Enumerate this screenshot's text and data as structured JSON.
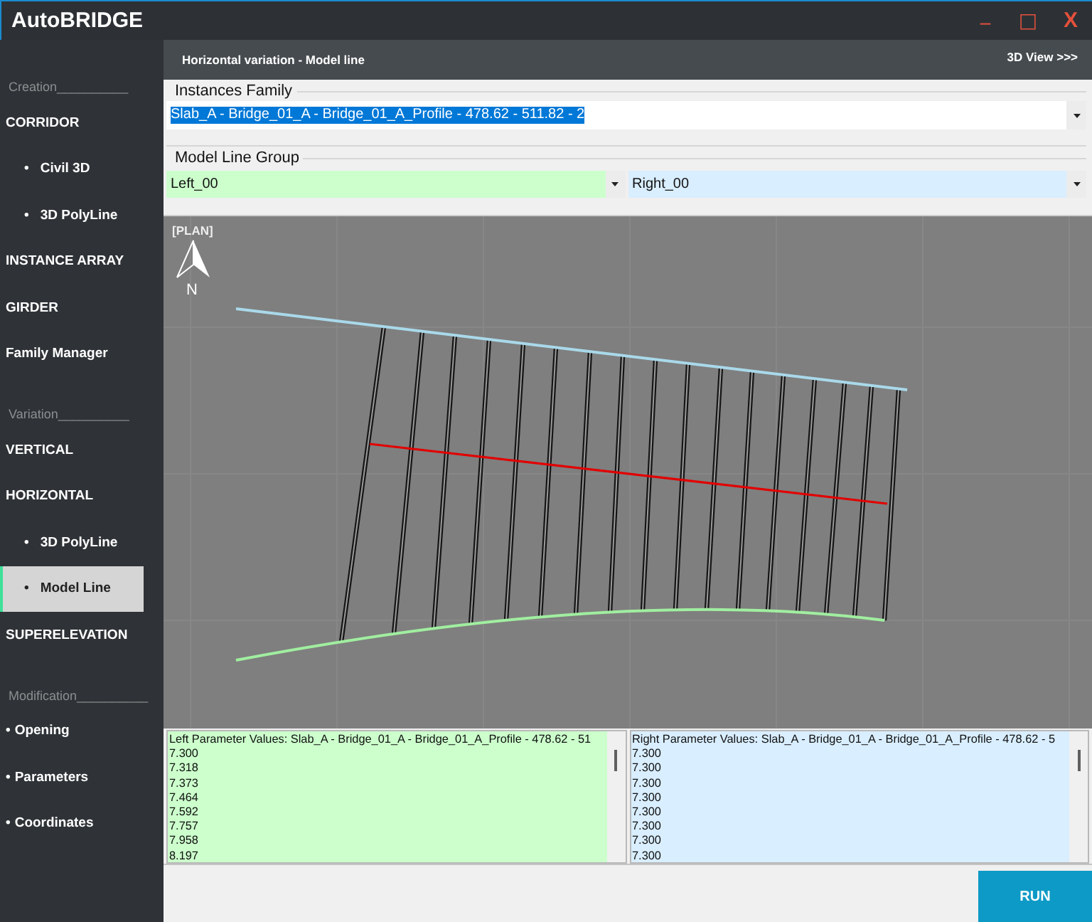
{
  "window": {
    "title": "AutoBRIDGE",
    "buttons": [
      {
        "kind": "minimize",
        "label": "_"
      },
      {
        "kind": "maximize",
        "label": "□"
      },
      {
        "kind": "close",
        "label": "X"
      }
    ]
  },
  "sidebar": {
    "sections": [
      {
        "heading": "Creation__________",
        "items": [
          {
            "label": "CORRIDOR",
            "selected": false,
            "children": [
              {
                "bullet": "•",
                "label": "Civil 3D",
                "selected": false
              },
              {
                "bullet": "•",
                "label": "3D PolyLine",
                "selected": false
              }
            ]
          },
          {
            "label": "INSTANCE ARRAY",
            "selected": false
          },
          {
            "label": "GIRDER",
            "selected": false
          },
          {
            "label": "Family Manager",
            "selected": false
          }
        ]
      },
      {
        "heading": "Variation__________",
        "items": [
          {
            "label": "VERTICAL",
            "selected": false
          },
          {
            "label": "HORIZONTAL",
            "selected": false,
            "children": [
              {
                "bullet": "•",
                "label": "3D PolyLine",
                "selected": false
              },
              {
                "bullet": "•",
                "label": "Model Line",
                "selected": true
              }
            ]
          },
          {
            "label": "SUPERELEVATION",
            "selected": false
          }
        ]
      },
      {
        "heading": "Modification__________",
        "items": [
          {
            "bullet": "•",
            "label": "Opening",
            "selected": false
          },
          {
            "bullet": "•",
            "label": "Parameters",
            "selected": false
          },
          {
            "bullet": "•",
            "label": "Coordinates",
            "selected": false
          }
        ]
      }
    ]
  },
  "panel": {
    "title": "Horizontal variation - Model line",
    "link": "3D View >>>"
  },
  "instances_family": {
    "label": "Instances Family",
    "value": "Slab_A - Bridge_01_A - Bridge_01_A_Profile - 478.62 - 511.82 - 2",
    "highlighted": true
  },
  "model_line_group": {
    "label": "Model Line Group",
    "combos": [
      {
        "value": "Left_00",
        "color": "#ccffcc"
      },
      {
        "value": "Right_00",
        "color": "#d9eeff"
      }
    ]
  },
  "plan": {
    "label": "[PLAN]",
    "north": "N"
  },
  "parameter_lists": [
    {
      "title": "Left Parameter Values: Slab_A - Bridge_01_A - Bridge_01_A_Profile - 478.62 - 51",
      "color": "#ccffcc",
      "values": [
        "7.300",
        "7.318",
        "7.373",
        "7.464",
        "7.592",
        "7.757",
        "7.958",
        "8.197"
      ]
    },
    {
      "title": "Right Parameter Values: Slab_A - Bridge_01_A - Bridge_01_A_Profile - 478.62 - 5",
      "color": "#d9eeff",
      "values": [
        "7.300",
        "7.300",
        "7.300",
        "7.300",
        "7.300",
        "7.300",
        "7.300",
        "7.300"
      ]
    }
  ],
  "run_button": "RUN"
}
